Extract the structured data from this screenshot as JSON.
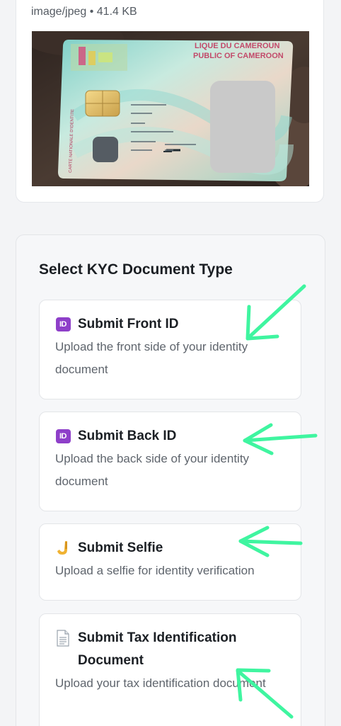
{
  "file": {
    "meta": "image/jpeg • 41.4 KB"
  },
  "photo": {
    "card_text_line1": "LIQUE DU CAMEROUN",
    "card_text_line2": "PUBLIC OF CAMEROON",
    "side_text": "CARTE NATIONALE D'IDENTITE"
  },
  "kyc": {
    "title": "Select KYC Document Type",
    "options": [
      {
        "icon": "id-badge-icon",
        "icon_text": "ID",
        "title": "Submit Front ID",
        "description": "Upload the front side of your identity document"
      },
      {
        "icon": "id-badge-icon",
        "icon_text": "ID",
        "title": "Submit Back ID",
        "description": "Upload the back side of your identity document"
      },
      {
        "icon": "selfie-hand-icon",
        "title": "Submit Selfie",
        "description": "Upload a selfie for identity verification"
      },
      {
        "icon": "document-icon",
        "title": "Submit Tax Identification Document",
        "description": "Upload your tax identification document"
      }
    ]
  },
  "colors": {
    "id_badge": "#8e3fc9",
    "arrow": "#3ff5a0",
    "card_bg": "#ffffff",
    "section_bg": "#f6f7f9"
  }
}
